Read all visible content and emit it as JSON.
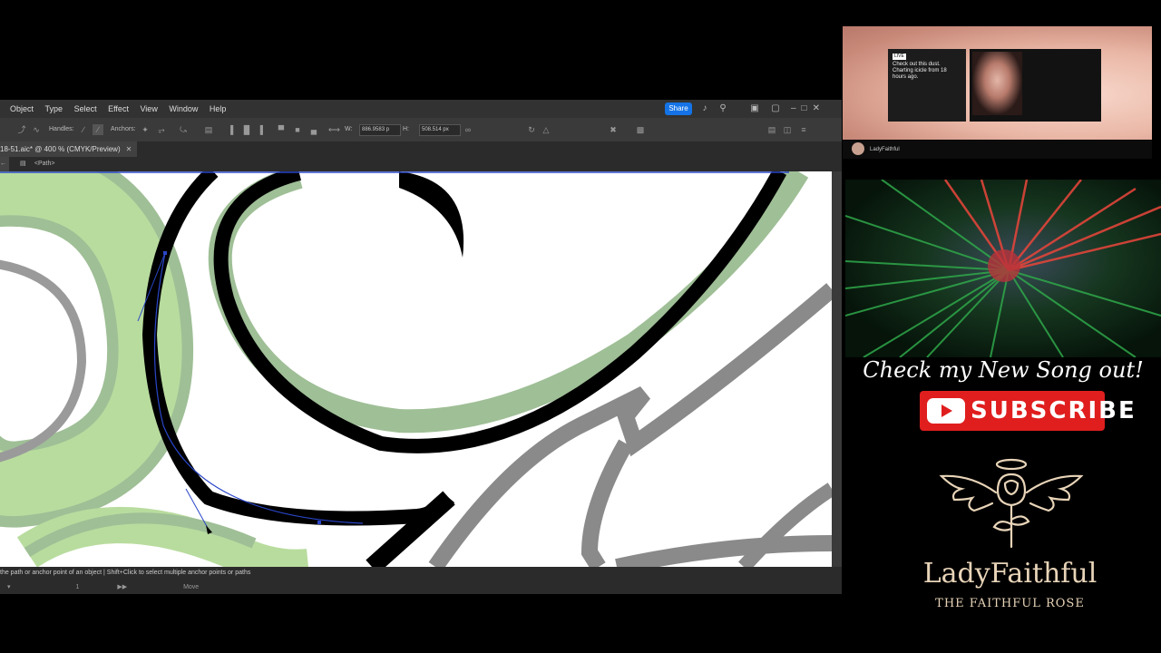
{
  "illustrator": {
    "menu": [
      "Object",
      "Type",
      "Select",
      "Effect",
      "View",
      "Window",
      "Help"
    ],
    "share_label": "Share",
    "control": {
      "handles_label": "Handles:",
      "anchors_label": "Anchors:",
      "width_value": "886.9583 p",
      "height_value": "508.514 px",
      "width_label": "W:",
      "height_label": "H:"
    },
    "doc_tab": "18-51.aic* @ 400 % (CMYK/Preview)",
    "breadcrumb": "<Path>",
    "status_hint": "the path or anchor point of an object  |  Shift+Click to select multiple anchor points or paths",
    "status_bottom": [
      "1",
      "Move"
    ]
  },
  "stream": {
    "cam_card_badge": "LIVE",
    "cam_card_text": "Check out this dust. Charting icicle from 18 hours ago.",
    "cam_name": "LadyFaithful",
    "song_text": "Check my New Song out!",
    "subscribe_label": "SUBSCRIBE",
    "brand_name": "LadyFaithful",
    "brand_tagline": "THE FAITHFUL ROSE"
  },
  "colors": {
    "accent_blue": "#1473e6",
    "youtube_red": "#e01e1e",
    "brand_gold": "#e8d4b8",
    "sage_green": "#9fbf96",
    "light_green": "#b8dc9e"
  }
}
